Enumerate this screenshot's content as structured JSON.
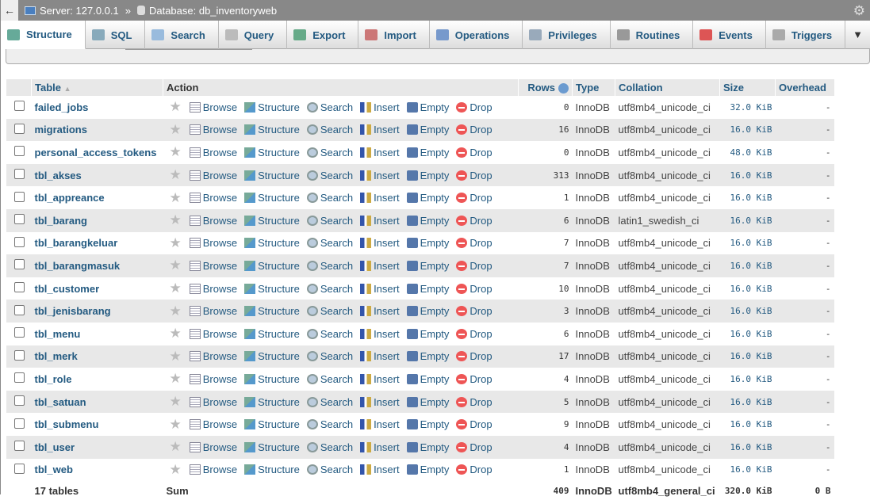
{
  "breadcrumb": {
    "server": "Server: 127.0.0.1",
    "separator": "»",
    "database": "Database: db_inventoryweb"
  },
  "tabs": [
    {
      "label": "Structure",
      "icon": "structure-icon",
      "color": "#6a9"
    },
    {
      "label": "SQL",
      "icon": "sql-icon",
      "color": "#8ab"
    },
    {
      "label": "Search",
      "icon": "search-icon",
      "color": "#9bd"
    },
    {
      "label": "Query",
      "icon": "query-icon",
      "color": "#bbb"
    },
    {
      "label": "Export",
      "icon": "export-icon",
      "color": "#6a8"
    },
    {
      "label": "Import",
      "icon": "import-icon",
      "color": "#c77"
    },
    {
      "label": "Operations",
      "icon": "wrench-icon",
      "color": "#79c"
    },
    {
      "label": "Privileges",
      "icon": "privileges-icon",
      "color": "#9ab"
    },
    {
      "label": "Routines",
      "icon": "routines-icon",
      "color": "#999"
    },
    {
      "label": "Events",
      "icon": "clock-icon",
      "color": "#d55"
    },
    {
      "label": "Triggers",
      "icon": "triggers-icon",
      "color": "#aaa"
    }
  ],
  "active_tab": "Structure",
  "header": {
    "table": "Table",
    "sort": "▲",
    "action": "Action",
    "rows": "Rows",
    "type": "Type",
    "collation": "Collation",
    "size": "Size",
    "overhead": "Overhead"
  },
  "actions": {
    "browse": "Browse",
    "structure": "Structure",
    "search": "Search",
    "insert": "Insert",
    "empty": "Empty",
    "drop": "Drop"
  },
  "tables": [
    {
      "name": "failed_jobs",
      "rows": "0",
      "type": "InnoDB",
      "collation": "utf8mb4_unicode_ci",
      "size": "32.0 KiB",
      "overhead": "-"
    },
    {
      "name": "migrations",
      "rows": "16",
      "type": "InnoDB",
      "collation": "utf8mb4_unicode_ci",
      "size": "16.0 KiB",
      "overhead": "-"
    },
    {
      "name": "personal_access_tokens",
      "rows": "0",
      "type": "InnoDB",
      "collation": "utf8mb4_unicode_ci",
      "size": "48.0 KiB",
      "overhead": "-"
    },
    {
      "name": "tbl_akses",
      "rows": "313",
      "type": "InnoDB",
      "collation": "utf8mb4_unicode_ci",
      "size": "16.0 KiB",
      "overhead": "-"
    },
    {
      "name": "tbl_appreance",
      "rows": "1",
      "type": "InnoDB",
      "collation": "utf8mb4_unicode_ci",
      "size": "16.0 KiB",
      "overhead": "-"
    },
    {
      "name": "tbl_barang",
      "rows": "6",
      "type": "InnoDB",
      "collation": "latin1_swedish_ci",
      "size": "16.0 KiB",
      "overhead": "-"
    },
    {
      "name": "tbl_barangkeluar",
      "rows": "7",
      "type": "InnoDB",
      "collation": "utf8mb4_unicode_ci",
      "size": "16.0 KiB",
      "overhead": "-"
    },
    {
      "name": "tbl_barangmasuk",
      "rows": "7",
      "type": "InnoDB",
      "collation": "utf8mb4_unicode_ci",
      "size": "16.0 KiB",
      "overhead": "-"
    },
    {
      "name": "tbl_customer",
      "rows": "10",
      "type": "InnoDB",
      "collation": "utf8mb4_unicode_ci",
      "size": "16.0 KiB",
      "overhead": "-"
    },
    {
      "name": "tbl_jenisbarang",
      "rows": "3",
      "type": "InnoDB",
      "collation": "utf8mb4_unicode_ci",
      "size": "16.0 KiB",
      "overhead": "-"
    },
    {
      "name": "tbl_menu",
      "rows": "6",
      "type": "InnoDB",
      "collation": "utf8mb4_unicode_ci",
      "size": "16.0 KiB",
      "overhead": "-"
    },
    {
      "name": "tbl_merk",
      "rows": "17",
      "type": "InnoDB",
      "collation": "utf8mb4_unicode_ci",
      "size": "16.0 KiB",
      "overhead": "-"
    },
    {
      "name": "tbl_role",
      "rows": "4",
      "type": "InnoDB",
      "collation": "utf8mb4_unicode_ci",
      "size": "16.0 KiB",
      "overhead": "-"
    },
    {
      "name": "tbl_satuan",
      "rows": "5",
      "type": "InnoDB",
      "collation": "utf8mb4_unicode_ci",
      "size": "16.0 KiB",
      "overhead": "-"
    },
    {
      "name": "tbl_submenu",
      "rows": "9",
      "type": "InnoDB",
      "collation": "utf8mb4_unicode_ci",
      "size": "16.0 KiB",
      "overhead": "-"
    },
    {
      "name": "tbl_user",
      "rows": "4",
      "type": "InnoDB",
      "collation": "utf8mb4_unicode_ci",
      "size": "16.0 KiB",
      "overhead": "-"
    },
    {
      "name": "tbl_web",
      "rows": "1",
      "type": "InnoDB",
      "collation": "utf8mb4_unicode_ci",
      "size": "16.0 KiB",
      "overhead": "-"
    }
  ],
  "footer": {
    "count": "17 tables",
    "sum": "Sum",
    "rows": "409",
    "type": "InnoDB",
    "collation": "utf8mb4_general_ci",
    "size": "320.0 KiB",
    "overhead": "0 B"
  }
}
